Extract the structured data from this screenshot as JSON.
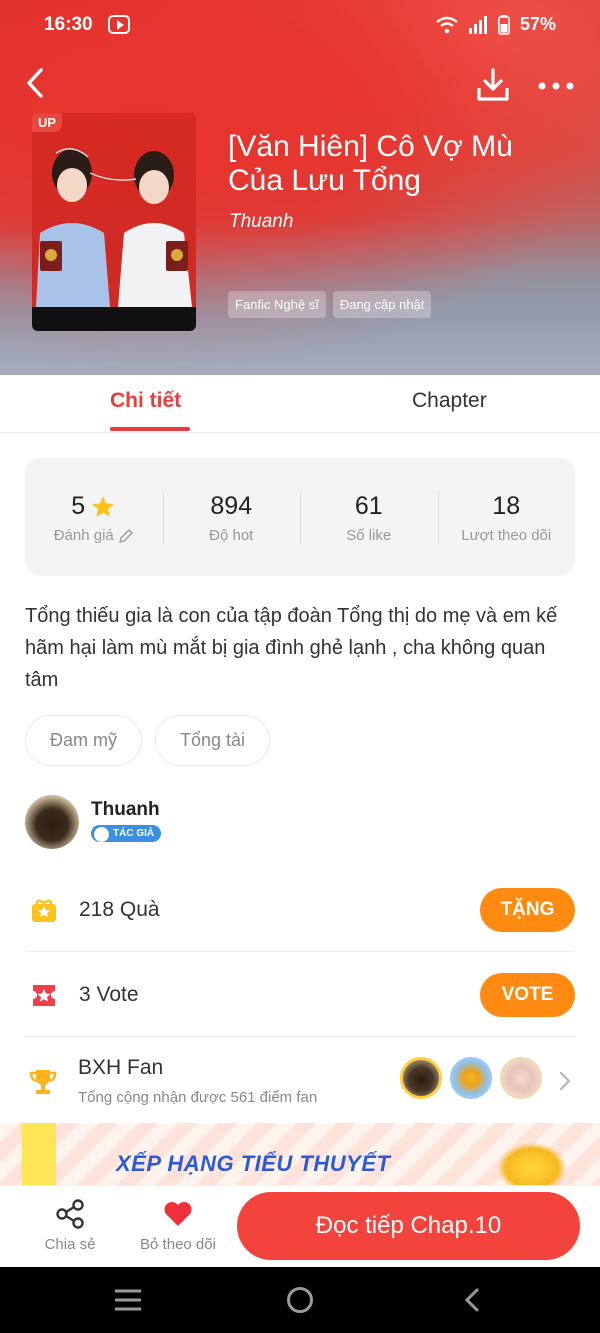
{
  "status_bar": {
    "time": "16:30",
    "battery": "57%"
  },
  "book": {
    "title": "[Văn Hiên] Cô Vợ Mù Của Lưu Tổng",
    "author": "Thuanh",
    "up_badge": "UP",
    "tags": [
      "Fanfic Nghệ sĩ",
      "Đang cập nhật"
    ]
  },
  "tabs": {
    "detail": "Chi tiết",
    "chapter": "Chapter"
  },
  "stats": [
    {
      "value": "5",
      "label": "Đánh giá"
    },
    {
      "value": "894",
      "label": "Độ hot"
    },
    {
      "value": "61",
      "label": "Số like"
    },
    {
      "value": "18",
      "label": "Lượt theo dõi"
    }
  ],
  "description": "Tổng thiếu gia là con của tập đoàn Tổng thị do mẹ và em kế hãm hại làm mù mắt bị gia đình ghẻ lạnh , cha không quan tâm",
  "genres": [
    "Đam mỹ",
    "Tổng tài"
  ],
  "author_card": {
    "name": "Thuanh",
    "badge": "TÁC GIẢ"
  },
  "gifts": {
    "text": "218  Quà",
    "button": "TẶNG"
  },
  "votes": {
    "text": "3  Vote",
    "button": "VOTE"
  },
  "fan_ranking": {
    "title": "BXH Fan",
    "subtitle": "Tổng cộng nhận được 561 điểm fan"
  },
  "banner": {
    "text": "XẾP HẠNG TIỂU THUYẾT"
  },
  "bottom_bar": {
    "share": "Chia sẻ",
    "unfollow": "Bỏ theo dõi",
    "read": "Đọc tiếp Chap.10"
  },
  "colors": {
    "accent": "#f2443d",
    "orange": "#ff8a12",
    "tab_active": "#ec3b3b"
  }
}
